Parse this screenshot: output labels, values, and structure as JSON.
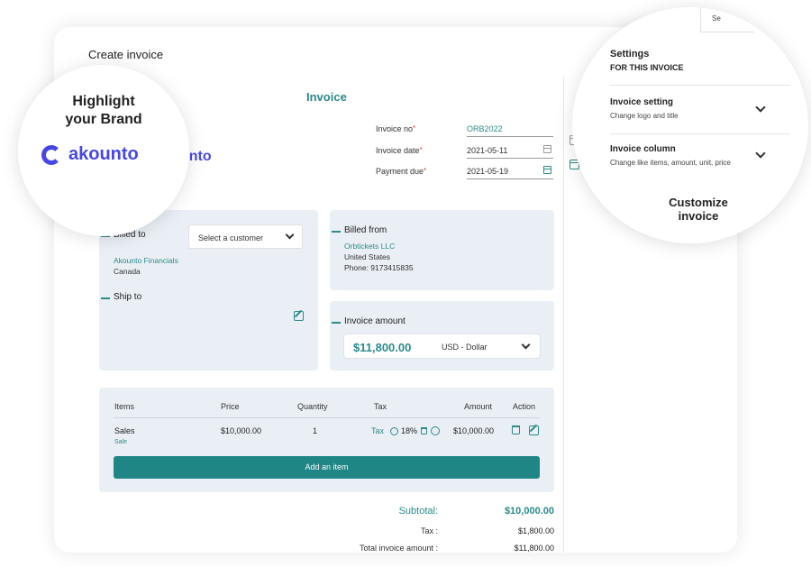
{
  "page": {
    "title": "Create invoice",
    "settings_tab_stub": "Se",
    "invoice_heading": "Invoice",
    "partial_logo_text": "unto"
  },
  "meta": {
    "invoice_no_label": "Invoice no",
    "invoice_no_value": "ORB2022",
    "invoice_date_label": "Invoice date",
    "invoice_date_value": "2021-05-11",
    "payment_due_label": "Payment due",
    "payment_due_value": "2021-05-19",
    "required_mark": "*"
  },
  "billed_to": {
    "label": "Billed to",
    "select_placeholder": "Select a customer",
    "customer_name": "Akounto Financials",
    "customer_country": "Canada",
    "ship_to_label": "Ship to"
  },
  "billed_from": {
    "label": "Billed from",
    "company": "Orbtickets LLC",
    "country": "United States",
    "phone": "Phone: 9173415835"
  },
  "invoice_amount": {
    "label": "Invoice amount",
    "value": "$11,800.00",
    "currency": "USD - Dollar"
  },
  "items_table": {
    "headers": [
      "Items",
      "Price",
      "Quantity",
      "Tax",
      "Amount",
      "Action"
    ],
    "rows": [
      {
        "item": "Sales",
        "item_sub": "Sale",
        "price": "$10,000.00",
        "quantity": "1",
        "tax_label": "Tax",
        "tax_rate": "18%",
        "amount": "$10,000.00"
      }
    ],
    "add_item_label": "Add an item"
  },
  "totals": {
    "subtotal_label": "Subtotal:",
    "subtotal_value": "$10,000.00",
    "tax_label": "Tax :",
    "tax_value": "$1,800.00",
    "total_label": "Total invoice amount :",
    "total_value": "$11,800.00"
  },
  "brand_bubble": {
    "heading_line1": "Highlight",
    "heading_line2": "your Brand",
    "logo_text": "akounto"
  },
  "settings_bubble": {
    "tab_stub": "Se",
    "title": "Settings",
    "subtitle": "FOR THIS INVOICE",
    "items": [
      {
        "title": "Invoice setting",
        "desc": "Change logo and title"
      },
      {
        "title": "Invoice column",
        "desc": "Change like items, amount, unit, price"
      }
    ],
    "callout_line1": "Customize",
    "callout_line2": "invoice"
  },
  "colors": {
    "accent": "#2b8a8a",
    "brand": "#4747e8",
    "panel_bg": "#e9eff5",
    "required": "#e0443a"
  }
}
